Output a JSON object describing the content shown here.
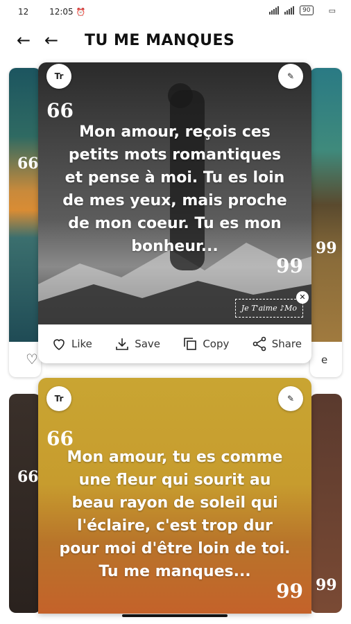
{
  "status_bar": {
    "left_number": "12",
    "time": "12:05",
    "battery": "90"
  },
  "header": {
    "title": "TU ME MANQUES"
  },
  "card1": {
    "quote": "Mon amour, reçois ces petits mots romantiques et pense à moi. Tu es loin de mes yeux, mais proche de mon coeur. Tu es mon bonheur...",
    "open_quote": "66",
    "close_quote": "99",
    "font_button": "Tr",
    "sticker": "Je T'aime ♪Mo",
    "actions": {
      "like": "Like",
      "save": "Save",
      "copy": "Copy",
      "share": "Share"
    }
  },
  "card2": {
    "quote": "Mon amour, tu es comme une fleur qui sourit au beau rayon de soleil qui l'éclaire, c'est trop dur pour moi d'être loin de toi. Tu me manques...",
    "open_quote": "66",
    "close_quote": "99",
    "font_button": "Tr"
  },
  "side_cards": {
    "left_fragment_quote": "66",
    "right_fragment_quote": "99",
    "right_fragment_letter": "e"
  }
}
